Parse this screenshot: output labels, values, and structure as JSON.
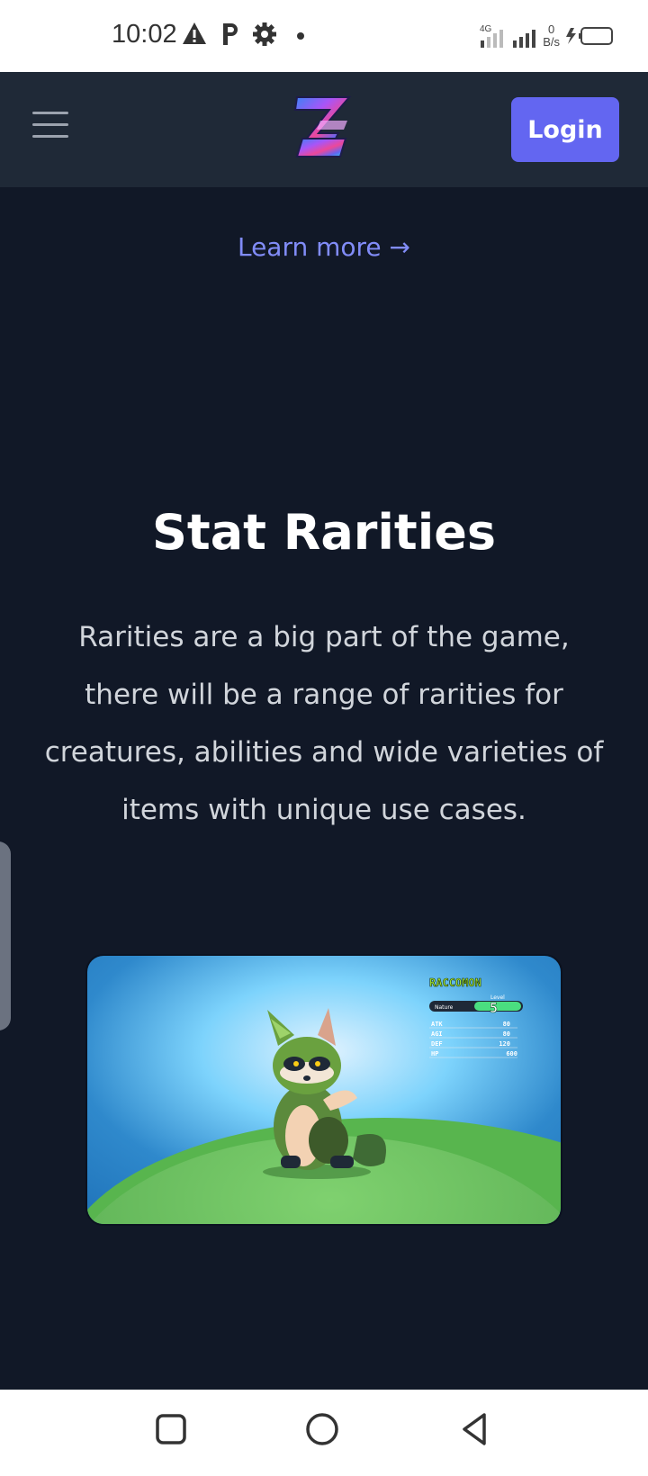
{
  "status_bar": {
    "time": "10:02",
    "speed_value": "0",
    "speed_unit": "B/s",
    "network": "4G"
  },
  "header": {
    "menu_icon": "hamburger-menu-icon",
    "logo": "Z-logo",
    "login_label": "Login"
  },
  "learn_more": "Learn more →",
  "section": {
    "title": "Stat Rarities",
    "description": "Rarities are a big part of the game, there will be a range of rarities for creatures, abilities and wide varieties of items with unique use cases."
  },
  "game_card": {
    "name": "RACCOMON",
    "type": "Nature",
    "level_label": "Level",
    "level": "5",
    "stats": [
      {
        "label": "ATK",
        "value": "80"
      },
      {
        "label": "AGI",
        "value": "80"
      },
      {
        "label": "DEF",
        "value": "120"
      },
      {
        "label": "HP",
        "value": "600"
      }
    ]
  },
  "nav_bar": {
    "recent": "square-icon",
    "home": "circle-icon",
    "back": "triangle-back-icon"
  },
  "colors": {
    "accent": "#6366f1",
    "link": "#818cf8",
    "background": "#111827",
    "header": "#1f2937"
  }
}
